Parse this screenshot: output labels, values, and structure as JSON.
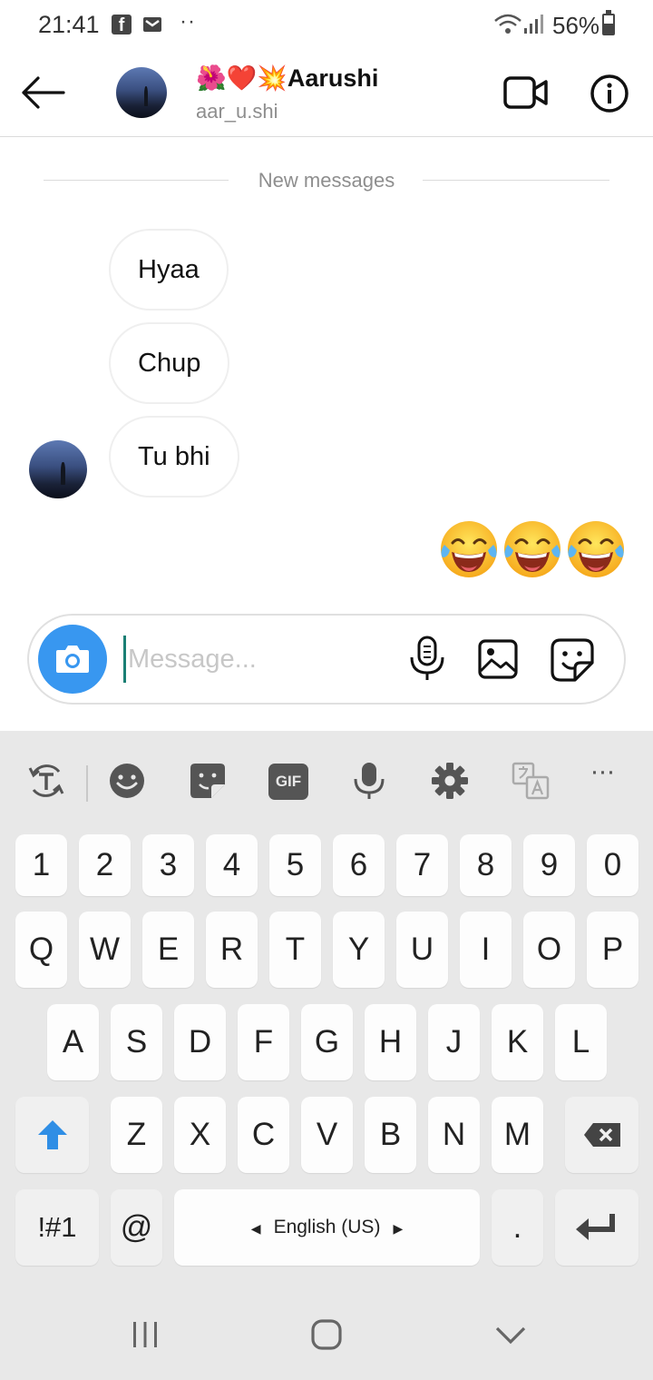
{
  "status_bar": {
    "time": "21:41",
    "dots": "··",
    "battery": "56%",
    "battery_level": 0.56,
    "icons": [
      "facebook-icon",
      "gmail-icon",
      "wifi-icon",
      "signal-icon",
      "battery-icon"
    ]
  },
  "header": {
    "name_emoji": "🌺❤️💥",
    "name": "Aarushi",
    "username": "aar_u.shi"
  },
  "chat": {
    "divider_label": "New messages",
    "messages": [
      {
        "text": "Hyaa",
        "sender": "other"
      },
      {
        "text": "Chup",
        "sender": "other"
      },
      {
        "text": "Tu bhi",
        "sender": "other"
      }
    ],
    "sent_emoji": "😂😂😂"
  },
  "composer": {
    "placeholder": "Message..."
  },
  "keyboard": {
    "row_numbers": [
      "1",
      "2",
      "3",
      "4",
      "5",
      "6",
      "7",
      "8",
      "9",
      "0"
    ],
    "row_q": [
      "Q",
      "W",
      "E",
      "R",
      "T",
      "Y",
      "U",
      "I",
      "O",
      "P"
    ],
    "row_a": [
      "A",
      "S",
      "D",
      "F",
      "G",
      "H",
      "J",
      "K",
      "L"
    ],
    "row_z": [
      "Z",
      "X",
      "C",
      "V",
      "B",
      "N",
      "M"
    ],
    "symbols_label": "!#1",
    "at_label": "@",
    "space_label": "English (US)",
    "period_label": ".",
    "gif_label": "GIF",
    "more_label": "···"
  },
  "colors": {
    "accent_blue": "#3897f0",
    "shift_blue": "#2f8ee5",
    "keyboard_bg": "#e8e8e8",
    "cursor": "#1a7f74"
  }
}
